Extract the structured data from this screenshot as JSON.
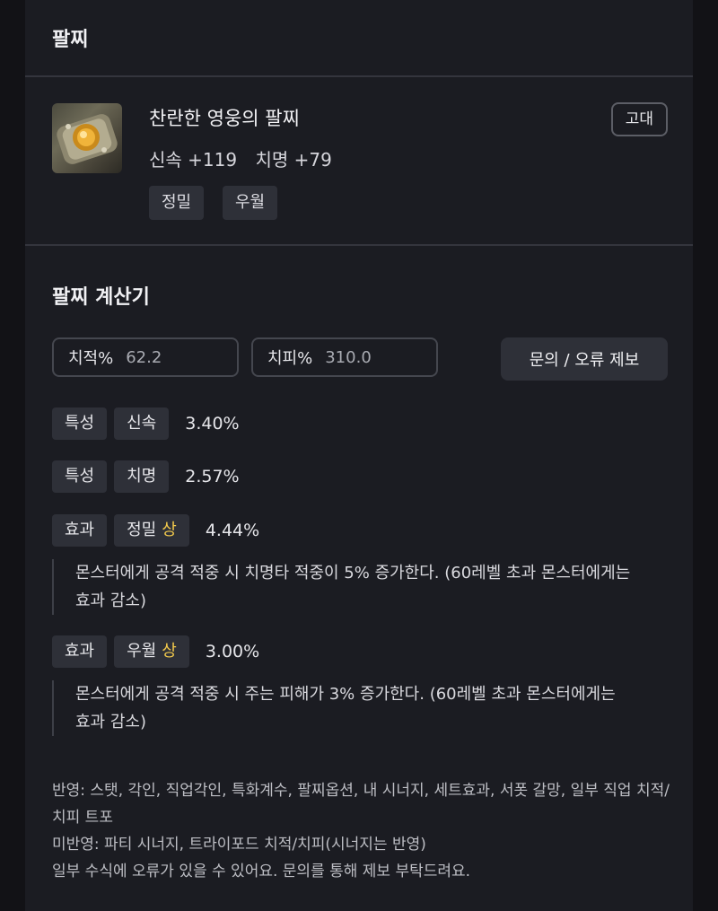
{
  "bracelet": {
    "section_title": "팔찌",
    "item": {
      "icon": "bracelet-item-icon",
      "name": "찬란한 영웅의 팔찌",
      "grade": "고대",
      "stats": [
        {
          "label": "신속 +119"
        },
        {
          "label": "치명 +79"
        }
      ],
      "tags": [
        "정밀",
        "우월"
      ]
    }
  },
  "calculator": {
    "title": "팔찌 계산기",
    "crit_rate": {
      "label": "치적%",
      "value": "62.2"
    },
    "crit_damage": {
      "label": "치피%",
      "value": "310.0"
    },
    "report_button": "문의 / 오류 제보",
    "rows": [
      {
        "type": "특성",
        "name": "신속",
        "grade": "",
        "value": "3.40%"
      },
      {
        "type": "특성",
        "name": "치명",
        "grade": "",
        "value": "2.57%"
      },
      {
        "type": "효과",
        "name": "정밀",
        "grade": "상",
        "value": "4.44%",
        "description": "몬스터에게 공격 적중 시 치명타 적중이 5% 증가한다. (60레벨 초과 몬스터에게는 효과 감소)"
      },
      {
        "type": "효과",
        "name": "우월",
        "grade": "상",
        "value": "3.00%",
        "description": "몬스터에게 공격 적중 시 주는 피해가 3% 증가한다. (60레벨 초과 몬스터에게는 효과 감소)"
      }
    ],
    "notes": [
      "반영: 스탯, 각인, 직업각인, 특화계수, 팔찌옵션, 내 시너지, 세트효과, 서폿 갈망, 일부 직업 치적/치피 트포",
      "미반영: 파티 시너지, 트라이포드 치적/치피(시너지는 반영)",
      "일부 수식에 오류가 있을 수 있어요. 문의를 통해 제보 부탁드려요."
    ]
  },
  "colors": {
    "background": "#121216",
    "panel": "#1b1c22",
    "chip": "#2e3038",
    "grade_highlight": "#f2c94c"
  }
}
